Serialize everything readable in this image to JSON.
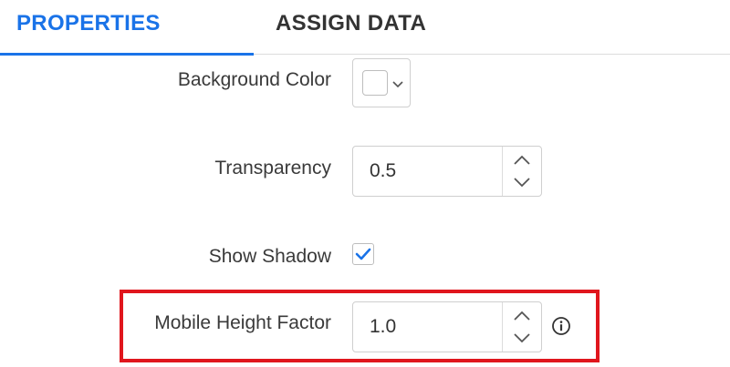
{
  "tabs": [
    {
      "label": "PROPERTIES",
      "active": true
    },
    {
      "label": "ASSIGN DATA",
      "active": false
    }
  ],
  "background_color": {
    "label": "Background Color",
    "value": "#ffffff"
  },
  "transparency": {
    "label": "Transparency",
    "value": "0.5"
  },
  "show_shadow": {
    "label": "Show Shadow",
    "checked": true
  },
  "mobile_height_factor": {
    "label": "Mobile Height Factor",
    "value": "1.0",
    "highlighted": true
  },
  "colors": {
    "accent": "#1a73e8",
    "highlight": "#e0161d",
    "text": "#333333"
  },
  "icons": {
    "color_dropdown": "chevron-down-icon",
    "stepper_up": "chevron-up-icon",
    "stepper_down": "chevron-down-icon",
    "checkbox": "checkmark-icon",
    "info": "info-icon"
  }
}
